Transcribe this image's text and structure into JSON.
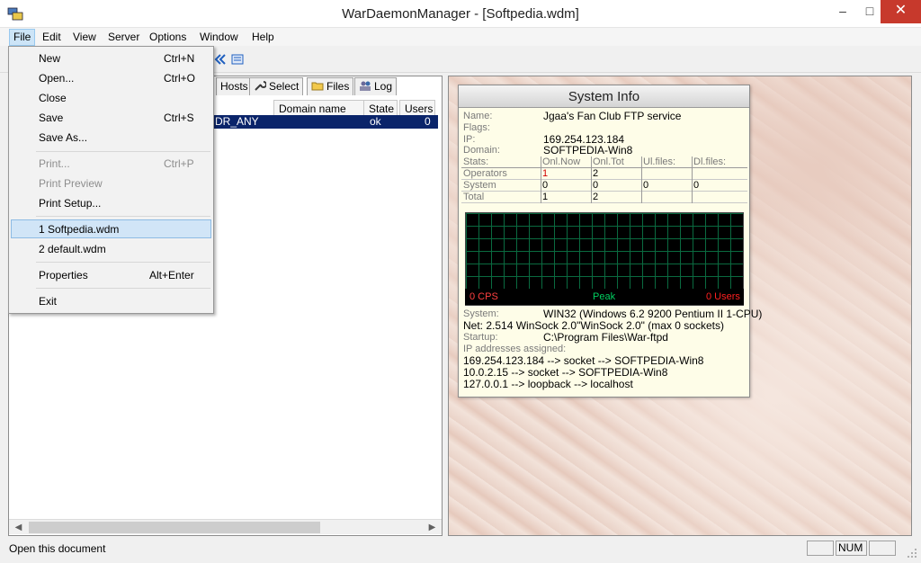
{
  "window": {
    "title": "WarDaemonManager - [Softpedia.wdm]",
    "minimize": "–",
    "maximize": "□",
    "close": "✕"
  },
  "menubar": [
    "File",
    "Edit",
    "View",
    "Server",
    "Options",
    "Window",
    "Help"
  ],
  "file_menu": {
    "items": [
      {
        "label": "New",
        "shortcut": "Ctrl+N",
        "enabled": true
      },
      {
        "label": "Open...",
        "shortcut": "Ctrl+O",
        "enabled": true
      },
      {
        "label": "Close",
        "shortcut": "",
        "enabled": true
      },
      {
        "label": "Save",
        "shortcut": "Ctrl+S",
        "enabled": true
      },
      {
        "label": "Save As...",
        "shortcut": "",
        "enabled": true
      },
      {
        "label": "Print...",
        "shortcut": "Ctrl+P",
        "enabled": false
      },
      {
        "label": "Print Preview",
        "shortcut": "",
        "enabled": false
      },
      {
        "label": "Print Setup...",
        "shortcut": "",
        "enabled": true
      },
      {
        "label": "1 Softpedia.wdm",
        "shortcut": "",
        "enabled": true
      },
      {
        "label": "2 default.wdm",
        "shortcut": "",
        "enabled": true
      },
      {
        "label": "Properties",
        "shortcut": "Alt+Enter",
        "enabled": true
      },
      {
        "label": "Exit",
        "shortcut": "",
        "enabled": true
      }
    ]
  },
  "tabs": [
    "Hosts",
    "Select",
    "Files",
    "Log"
  ],
  "columns": [
    "Domain name",
    "State",
    "Users"
  ],
  "selected_row": {
    "name_fragment": "DR_ANY",
    "state": "ok",
    "users": "0"
  },
  "sysinfo": {
    "title": "System Info",
    "name_label": "Name:",
    "name_value": "Jgaa's Fan Club FTP service",
    "flags_label": "Flags:",
    "ip_label": "IP:",
    "ip_value": "169.254.123.184",
    "domain_label": "Domain:",
    "domain_value": "SOFTPEDIA-Win8",
    "stats_headers": [
      "Stats:",
      "Onl.Now",
      "Onl.Tot",
      "Ul.files:",
      "Dl.files:"
    ],
    "stats_rows": [
      [
        "Operators",
        "1",
        "2",
        "",
        ""
      ],
      [
        "System",
        "0",
        "0",
        "0",
        "0"
      ],
      [
        "Total",
        "1",
        "2",
        "",
        ""
      ]
    ],
    "graph_cps": "0 CPS",
    "graph_peak": "Peak",
    "graph_users": "0 Users",
    "system_label": "System:",
    "system_value": "WIN32 (Windows 6.2 9200 Pentium II 1-CPU)",
    "net_line": "Net: 2.514 WinSock 2.0\"WinSock 2.0\" (max 0 sockets)",
    "startup_label": "Startup:",
    "startup_value": "C:\\Program Files\\War-ftpd",
    "ip_assigned_label": "IP addresses assigned:",
    "ip_lines": [
      "169.254.123.184 --> socket --> SOFTPEDIA-Win8",
      "10.0.2.15 --> socket --> SOFTPEDIA-Win8",
      "127.0.0.1 --> loopback --> localhost"
    ]
  },
  "colors": {
    "selection": "#0a246a",
    "operators_now": "#d00000",
    "cps": "#ff4040",
    "peak": "#00d060",
    "users": "#ff2020"
  },
  "statusbar": {
    "text": "Open this document",
    "num": "NUM"
  }
}
